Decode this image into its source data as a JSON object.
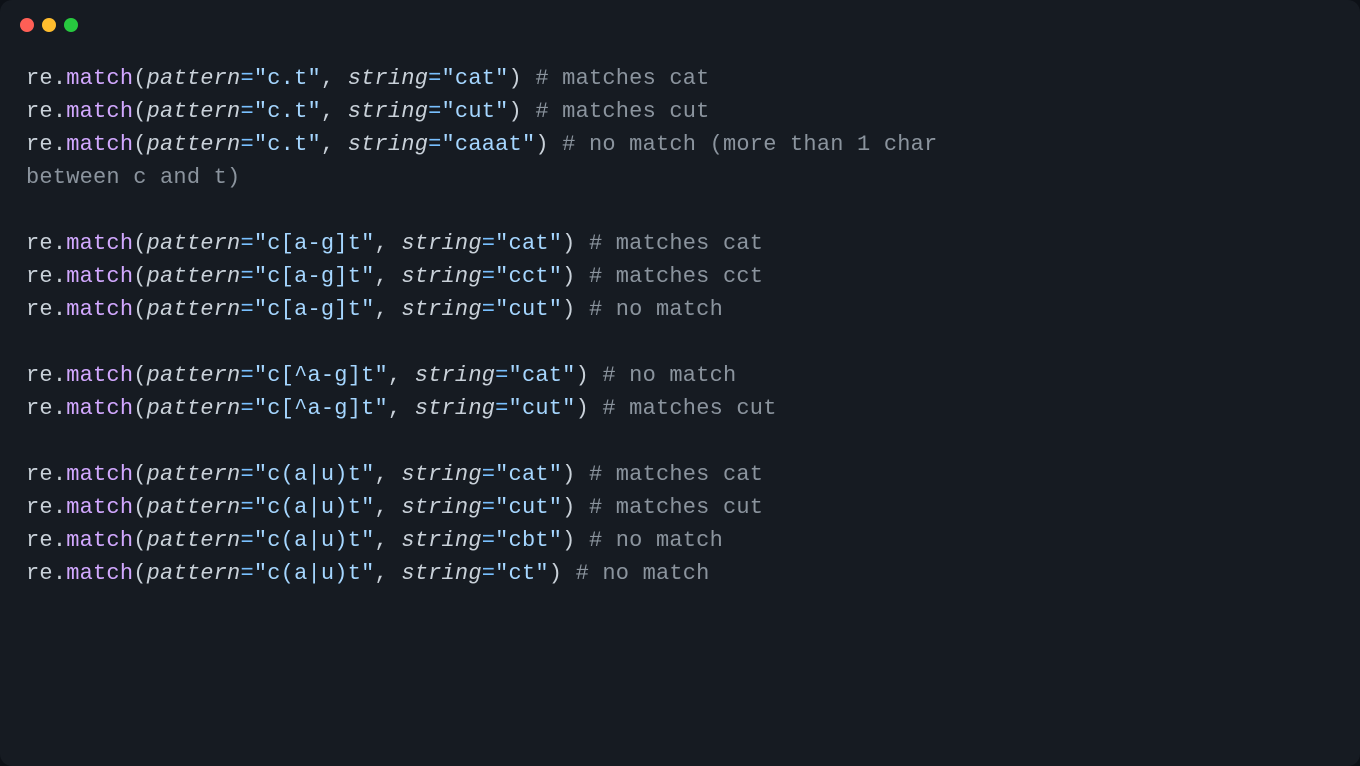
{
  "window": {
    "traffic_lights": [
      "red",
      "yellow",
      "green"
    ]
  },
  "code": {
    "module": "re",
    "func": "match",
    "param_pattern": "pattern",
    "param_string": "string",
    "eq": "=",
    "lines": [
      {
        "type": "call",
        "pattern": "\"c.t\"",
        "string": "\"cat\"",
        "comment": "# matches cat"
      },
      {
        "type": "call",
        "pattern": "\"c.t\"",
        "string": "\"cut\"",
        "comment": "# matches cut"
      },
      {
        "type": "call",
        "pattern": "\"c.t\"",
        "string": "\"caaat\"",
        "comment": "# no match (more than 1 char "
      },
      {
        "type": "comment_cont",
        "text": "between c and t)"
      },
      {
        "type": "blank"
      },
      {
        "type": "call",
        "pattern": "\"c[a-g]t\"",
        "string": "\"cat\"",
        "comment": "# matches cat"
      },
      {
        "type": "call",
        "pattern": "\"c[a-g]t\"",
        "string": "\"cct\"",
        "comment": "# matches cct"
      },
      {
        "type": "call",
        "pattern": "\"c[a-g]t\"",
        "string": "\"cut\"",
        "comment": "# no match"
      },
      {
        "type": "blank"
      },
      {
        "type": "call",
        "pattern": "\"c[^a-g]t\"",
        "string": "\"cat\"",
        "comment": "# no match"
      },
      {
        "type": "call",
        "pattern": "\"c[^a-g]t\"",
        "string": "\"cut\"",
        "comment": "# matches cut"
      },
      {
        "type": "blank"
      },
      {
        "type": "call",
        "pattern": "\"c(a|u)t\"",
        "string": "\"cat\"",
        "comment": "# matches cat"
      },
      {
        "type": "call",
        "pattern": "\"c(a|u)t\"",
        "string": "\"cut\"",
        "comment": "# matches cut"
      },
      {
        "type": "call",
        "pattern": "\"c(a|u)t\"",
        "string": "\"cbt\"",
        "comment": "# no match"
      },
      {
        "type": "call",
        "pattern": "\"c(a|u)t\"",
        "string": "\"ct\"",
        "comment": "# no match"
      }
    ]
  },
  "colors": {
    "bg": "#161b22",
    "func": "#d2a8ff",
    "string": "#a5d6ff",
    "op": "#79c0ff",
    "comment": "#8b949e",
    "text": "#c9d1d9"
  }
}
